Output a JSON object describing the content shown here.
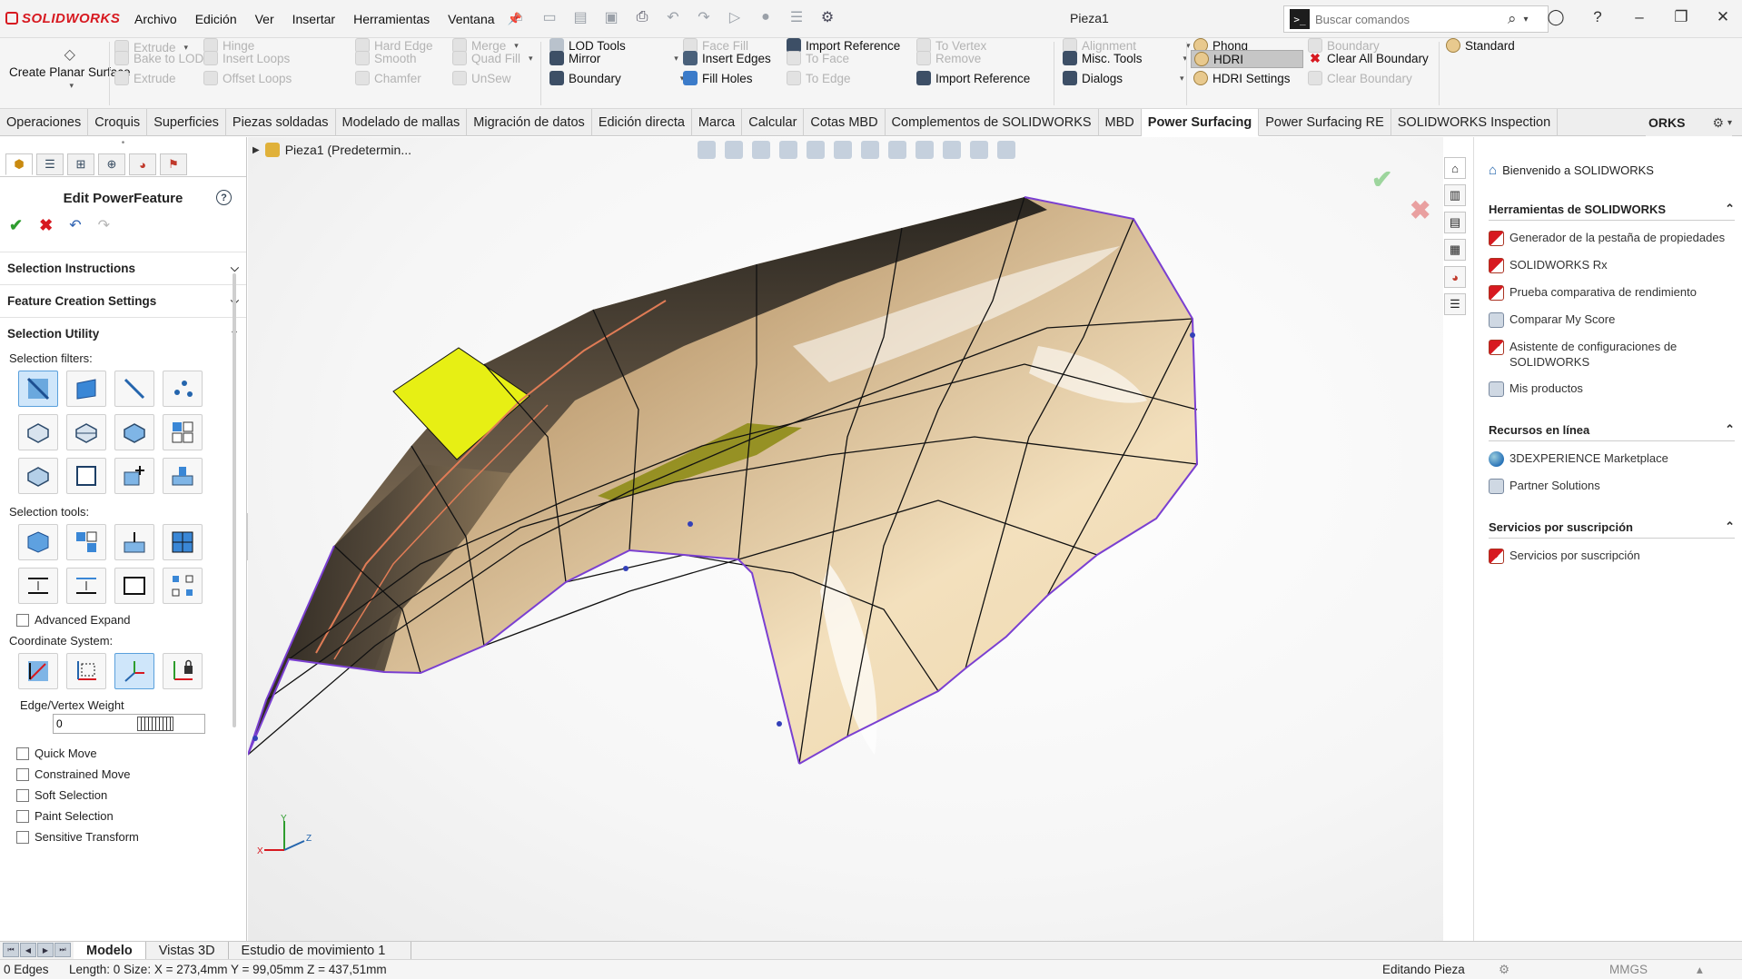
{
  "app": {
    "logo": "SOLIDWORKS",
    "document_title": "Pieza1"
  },
  "menu": [
    "Archivo",
    "Edición",
    "Ver",
    "Insertar",
    "Herramientas",
    "Ventana"
  ],
  "search": {
    "placeholder": "Buscar comandos"
  },
  "ribbon": {
    "planar": "Create Planar Surface",
    "col1": [
      "Extrude",
      "Bake to LOD",
      "Extrude"
    ],
    "col2": [
      "Hinge",
      "Insert Loops",
      "Offset Loops"
    ],
    "col3": [
      "Hard Edge",
      "Smooth",
      "Chamfer"
    ],
    "col4": [
      "Merge",
      "Quad Fill",
      "UnSew"
    ],
    "col5": [
      "LOD Tools",
      "Mirror",
      "Boundary"
    ],
    "col6": [
      "Face Fill",
      "Insert Edges",
      "Fill Holes"
    ],
    "col7": [
      "Import Reference",
      "To Face",
      "To Edge"
    ],
    "col8": [
      "To Vertex",
      "Remove",
      "Import Reference"
    ],
    "col9": [
      "Alignment",
      "Misc. Tools",
      "Dialogs"
    ],
    "col10": [
      "Phong",
      "HDRI",
      "HDRI Settings"
    ],
    "col11": [
      "Boundary",
      "Clear All Boundary",
      "Clear Boundary"
    ],
    "col12": [
      "Standard"
    ]
  },
  "tabs": [
    "Operaciones",
    "Croquis",
    "Superficies",
    "Piezas soldadas",
    "Modelado de mallas",
    "Migración de datos",
    "Edición directa",
    "Marca",
    "Calcular",
    "Cotas MBD",
    "Complementos de SOLIDWORKS",
    "MBD",
    "Power Surfacing",
    "Power Surfacing RE",
    "SOLIDWORKS Inspection"
  ],
  "tab_overflow": "ORKS",
  "property_manager": {
    "title": "Edit PowerFeature",
    "sections": {
      "selection_instructions": "Selection Instructions",
      "feature_creation": "Feature Creation Settings",
      "selection_utility": "Selection Utility"
    },
    "selection_filters_label": "Selection filters:",
    "selection_tools_label": "Selection tools:",
    "advanced_expand": "Advanced Expand",
    "coordinate_system_label": "Coordinate System:",
    "weight_label": "Edge/Vertex Weight",
    "weight_value": "0",
    "checkboxes": [
      "Quick Move",
      "Constrained Move",
      "Soft Selection",
      "Paint Selection",
      "Sensitive Transform"
    ]
  },
  "graphics": {
    "tree_node": "Pieza1 (Predetermin..."
  },
  "task_pane": {
    "welcome": "Bienvenido a SOLIDWORKS",
    "tools_header": "Herramientas de SOLIDWORKS",
    "tools": [
      "Generador de la pestaña de propiedades",
      "SOLIDWORKS Rx",
      "Prueba comparativa de rendimiento",
      "Comparar My Score",
      "Asistente de configuraciones de SOLIDWORKS",
      "Mis productos"
    ],
    "online_header": "Recursos en línea",
    "online": [
      "3DEXPERIENCE Marketplace",
      "Partner Solutions"
    ],
    "subscription_header": "Servicios por suscripción",
    "subscription": [
      "Servicios por suscripción"
    ]
  },
  "bottom_tabs": [
    "Modelo",
    "Vistas 3D",
    "Estudio de movimiento 1"
  ],
  "status": {
    "edges": "0 Edges",
    "measure": "Length: 0 Size: X = 273,4mm Y = 99,05mm Z = 437,51mm",
    "mode": "Editando Pieza",
    "units": "MMGS"
  },
  "colors": {
    "accent_red": "#d71920",
    "surface_tan": "#f1dcb6",
    "boundary_purple": "#7a3fd1",
    "selected_yellow": "#e7ef14"
  }
}
